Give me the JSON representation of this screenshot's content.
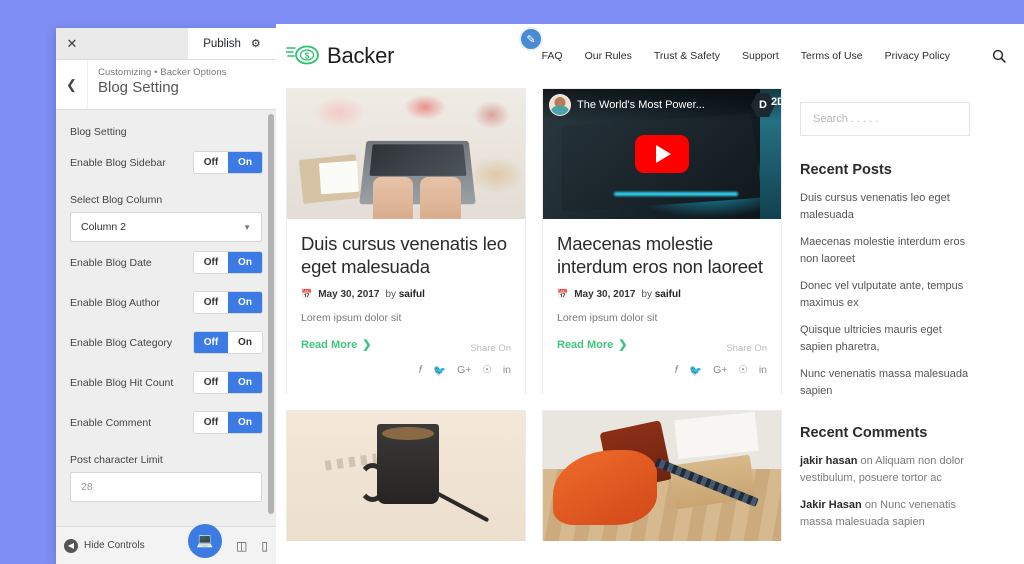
{
  "customizer": {
    "close_icon": "close-icon",
    "publish_label": "Publish",
    "gear_icon": "gear-icon",
    "back_icon": "chevron-left-icon",
    "breadcrumb": "Customizing • Backer Options",
    "title": "Blog Setting",
    "section_title": "Blog Setting",
    "toggle_off": "Off",
    "toggle_on": "On",
    "rows": [
      {
        "label": "Enable Blog Sidebar",
        "value": "On"
      },
      {
        "label": "Enable Blog Date",
        "value": "On"
      },
      {
        "label": "Enable Blog Author",
        "value": "On"
      },
      {
        "label": "Enable Blog Category",
        "value": "Off"
      },
      {
        "label": "Enable Blog Hit Count",
        "value": "On"
      },
      {
        "label": "Enable Comment",
        "value": "On"
      }
    ],
    "select": {
      "label": "Select Blog Column",
      "value": "Column 2",
      "caret_icon": "chevron-down-icon"
    },
    "char_limit": {
      "label": "Post character Limit",
      "value": "28"
    },
    "bottom": {
      "hide_controls": "Hide Controls",
      "hide_icon": "collapse-icon",
      "desktop_icon": "desktop-icon",
      "tablet_icon": "tablet-icon",
      "mobile_icon": "mobile-icon"
    }
  },
  "site": {
    "logo_text": "Backer",
    "logo_icon": "money-flying-icon",
    "edit_icon": "pencil-edit-icon",
    "search_icon": "search-icon",
    "nav": [
      "FAQ",
      "Our Rules",
      "Trust & Safety",
      "Support",
      "Terms of Use",
      "Privacy Policy"
    ],
    "posts": [
      {
        "media": "desk-flatlay-photo",
        "title": "Duis cursus venenatis leo eget malesuada",
        "date": "May 30, 2017",
        "by_prefix": "by",
        "author": "saiful",
        "excerpt": "Lorem ipsum dolor sit",
        "read_more": "Read More",
        "share_on": "Share On"
      },
      {
        "media": "youtube-embed",
        "video_title": "The World's Most Power...",
        "video_logo": "D",
        "video_logo_alt": "2D",
        "title": "Maecenas molestie interdum eros non laoreet",
        "date": "May 30, 2017",
        "by_prefix": "by",
        "author": "saiful",
        "excerpt": "Lorem ipsum dolor sit",
        "read_more": "Read More",
        "share_on": "Share On"
      },
      {
        "media": "coffee-mug-photo"
      },
      {
        "media": "orange-chair-desk-photo"
      }
    ],
    "share_icons": [
      "facebook-icon",
      "twitter-icon",
      "google-plus-icon",
      "pinterest-icon",
      "linkedin-icon"
    ],
    "sidebar": {
      "search_placeholder": "Search . . . . .",
      "recent_posts_title": "Recent Posts",
      "recent_posts": [
        "Duis cursus venenatis leo eget malesuada",
        "Maecenas molestie interdum eros non laoreet",
        "Donec vel vulputate ante, tempus maximus ex",
        "Quisque ultricies mauris eget sapien pharetra,",
        "Nunc venenatis massa malesuada sapien"
      ],
      "recent_comments_title": "Recent Comments",
      "recent_comments": [
        {
          "author": "jakir hasan",
          "on": "on",
          "post": "Aliquam non dolor vestibulum, posuere tortor ac"
        },
        {
          "author": "Jakir Hasan",
          "on": "on",
          "post": "Nunc venenatis massa malesuada sapien"
        }
      ]
    }
  },
  "colors": {
    "page_background": "#7e8ef5",
    "accent_blue": "#3c7ae4",
    "read_more_green": "#3fc57e",
    "youtube_red": "#ff0000"
  }
}
